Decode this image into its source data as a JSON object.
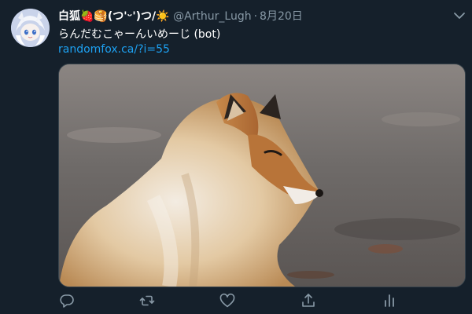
{
  "tweet": {
    "display_name": "白狐🍓🥞(つ'ᵕ')つ/☀️",
    "handle": "@Arthur_Lugh",
    "separator": "·",
    "date": "8月20日",
    "text": "らんだむこゃーんいめーじ (bot)",
    "link": "randomfox.ca/?i=55"
  },
  "icons": {
    "more": "chevron-down-icon",
    "reply": "reply-icon",
    "retweet": "retweet-icon",
    "like": "heart-icon",
    "share": "share-icon",
    "analytics": "analytics-icon"
  },
  "colors": {
    "background": "#15202b",
    "secondary_text": "#8899a6",
    "link": "#1da1f2",
    "border": "#38444d"
  }
}
